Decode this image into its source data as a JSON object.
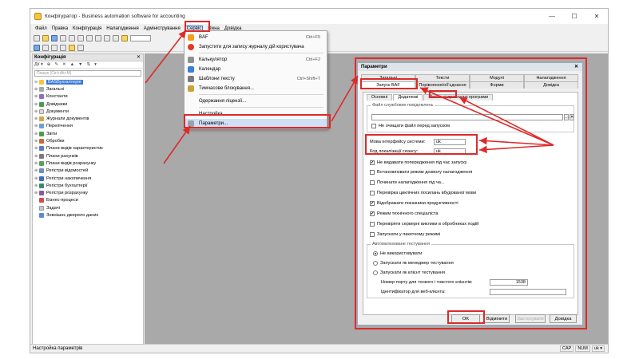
{
  "window": {
    "title": "Конфігуратор - Business automation software for accounting",
    "controls": [
      "—",
      "☐",
      "✕"
    ]
  },
  "menubar": {
    "items": [
      "Файл",
      "Правка",
      "Конфігурація",
      "Налагодження",
      "Адміністрування",
      "Сервіс",
      "Вікна",
      "Довідка"
    ],
    "active": "Сервіс"
  },
  "config_panel": {
    "title": "Конфігурація",
    "close": "✕",
    "actions_label": "Дії ▾",
    "tool_glyphs": [
      "⊕",
      "✎",
      "✕",
      "▲",
      "▼",
      "⇅",
      "▾"
    ],
    "search_placeholder": "Пошук (Ctrl+Alt+M)",
    "root": "BASБухгалтерія",
    "items": [
      "Загальні",
      "Константи",
      "Довідники",
      "Документи",
      "Журнали документів",
      "Перелічення",
      "Звіти",
      "Обробки",
      "Плани видів характеристик",
      "Плани рахунків",
      "Плани видів розрахунку",
      "Регістри відомостей",
      "Регістри накопичення",
      "Регістри бухгалтерії",
      "Регістри розрахунку",
      "Бізнес-процеси",
      "Задачі",
      "Зовнішнє джерело даних"
    ]
  },
  "service_menu": {
    "items": [
      {
        "label": "BAF",
        "shortcut": "Ctrl+F5",
        "icon": "baf-icon",
        "color": "#f0a11e"
      },
      {
        "label": "Запустити для запису журналу дій користувача",
        "shortcut": "",
        "icon": "record-icon",
        "color": "#e03a2a"
      },
      {
        "label": "Калькулятор",
        "shortcut": "Ctrl+F2",
        "icon": "calculator-icon",
        "color": "#8f8f8f"
      },
      {
        "label": "Календар",
        "shortcut": "",
        "icon": "calendar-icon",
        "color": "#3b7fd6"
      },
      {
        "label": "Шаблони тексту",
        "shortcut": "Ctrl+Shift+T",
        "icon": "template-icon",
        "color": "#7a7a7a"
      },
      {
        "label": "Тимчасове блокування...",
        "shortcut": "",
        "icon": "lock-icon",
        "color": "#c9a23a"
      },
      {
        "label": "Одержання ліцензії...",
        "shortcut": "",
        "icon": "",
        "color": ""
      },
      {
        "label": "Настройка...",
        "shortcut": "",
        "icon": "",
        "color": ""
      },
      {
        "label": "Параметри...",
        "shortcut": "",
        "icon": "settings-icon",
        "color": "#9aa2ad"
      }
    ]
  },
  "params_dialog": {
    "title": "Параметри",
    "close": "✕",
    "tabs_row1": [
      "Загальні",
      "Тексти",
      "Модулі",
      "Налагодження"
    ],
    "tabs_row2": [
      "Запуск BAF",
      "Порівняння/об'єднання",
      "Форми",
      "Довідка"
    ],
    "active_tab": "Запуск BAF",
    "subtabs": [
      "Основні",
      "Додаткові",
      "Мобільні прикладні програми"
    ],
    "active_subtab": "Додаткові",
    "service_messages_group": "Файл службових повідомлень",
    "service_messages_value": "",
    "no_clear_label": "Не очищати файл перед запуском",
    "interface_lang_label": "Мова інтерфейсу системи:",
    "interface_lang_value": "uk",
    "localization_label": "Код локалізації сеансу:",
    "localization_value": "uk",
    "checkboxes": [
      {
        "label": "Не видавати попередження під час запуску",
        "checked": true
      },
      {
        "label": "Встановлювати режим дозволу налагодження",
        "checked": false
      },
      {
        "label": "Починати налагодження під ча...",
        "checked": false
      },
      {
        "label": "Перевірка циклічних посилань вбудованої мови",
        "checked": false
      },
      {
        "label": "Відображати показники продуктивності",
        "checked": true
      },
      {
        "label": "Режим технічного спеціаліста",
        "checked": true
      },
      {
        "label": "Перевіряти серверні виклики в обробниках подій",
        "checked": false
      },
      {
        "label": "Запускати у пакетному режимі",
        "checked": false
      }
    ],
    "testing_group": "Автоматизоване тестування",
    "radios": [
      {
        "label": "Не використовувати",
        "selected": true
      },
      {
        "label": "Запускати як менеджер тестування",
        "selected": false
      },
      {
        "label": "Запускати як клієнт тестування",
        "selected": false
      }
    ],
    "port_label": "Номер порту для тонкого і товстого клієнтів:",
    "port_value": "1538",
    "webclient_label": "Ідентифікатор для веб-клієнта:",
    "webclient_value": "",
    "buttons": {
      "ok": "OK",
      "cancel": "Відмінити",
      "apply": "Застосувати",
      "help": "Довідка"
    }
  },
  "statusbar": {
    "text": "Настройка параметрів",
    "indicators": [
      "CAP",
      "NUM",
      "uk ▾"
    ]
  },
  "annotation_color": "#dd2a2a"
}
